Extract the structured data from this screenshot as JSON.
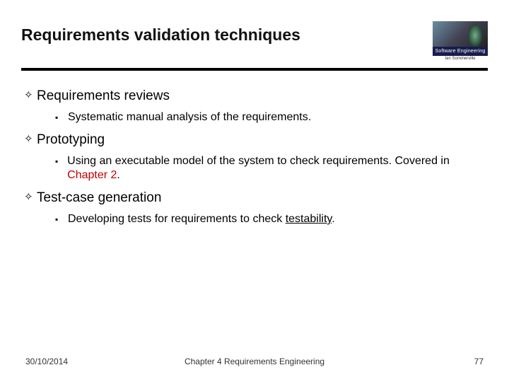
{
  "header": {
    "title": "Requirements validation techniques",
    "logo_band": "Software Engineering",
    "logo_author": "Ian Sommerville"
  },
  "bullets": [
    {
      "text": "Requirements reviews",
      "sub": [
        {
          "parts": [
            {
              "t": "Systematic manual analysis of the requirements."
            }
          ]
        }
      ]
    },
    {
      "text": "Prototyping",
      "sub": [
        {
          "parts": [
            {
              "t": "Using an executable model of the system to check requirements. Covered in "
            },
            {
              "t": "Chapter 2",
              "red": true
            },
            {
              "t": "."
            }
          ]
        }
      ]
    },
    {
      "text": "Test-case generation",
      "sub": [
        {
          "parts": [
            {
              "t": "Developing tests for requirements to check "
            },
            {
              "t": "testability",
              "ul": true
            },
            {
              "t": "."
            }
          ]
        }
      ]
    }
  ],
  "footer": {
    "date": "30/10/2014",
    "chapter": "Chapter 4 Requirements Engineering",
    "page": "77"
  }
}
